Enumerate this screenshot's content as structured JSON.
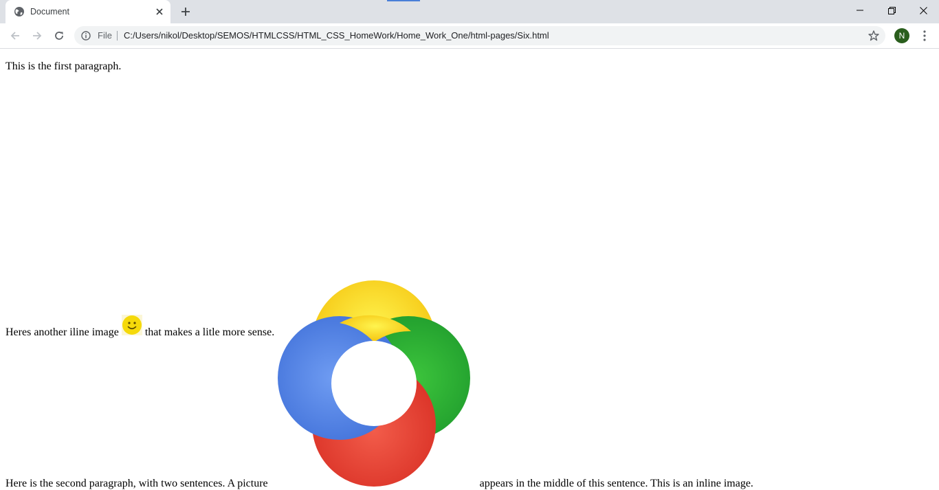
{
  "browser": {
    "tab_title": "Document",
    "url_scheme": "File",
    "url": "C:/Users/nikol/Desktop/SEMOS/HTMLCSS/HTML_CSS_HomeWork/Home_Work_One/html-pages/Six.html",
    "profile_initial": "N",
    "profile_color": "#2a5e1d"
  },
  "page": {
    "paragraph1": "This is the first paragraph.",
    "paragraph2_before": "Here is the second paragraph, with two sentences. A picture",
    "paragraph2_after": "appears in the middle of this sentence. This is an inline image.",
    "paragraph3_before": "Heres another iline image",
    "paragraph3_after": "that makes a litle more sense.",
    "big_image": "google-photos-style-ring-logo",
    "small_image": "smiley-face-icon"
  },
  "colors": {
    "ring_yellow": "#f7cf26",
    "ring_green": "#2ea62e",
    "ring_red": "#e33a2e",
    "ring_blue": "#4f7fe0",
    "smiley": "#f5d90a"
  }
}
